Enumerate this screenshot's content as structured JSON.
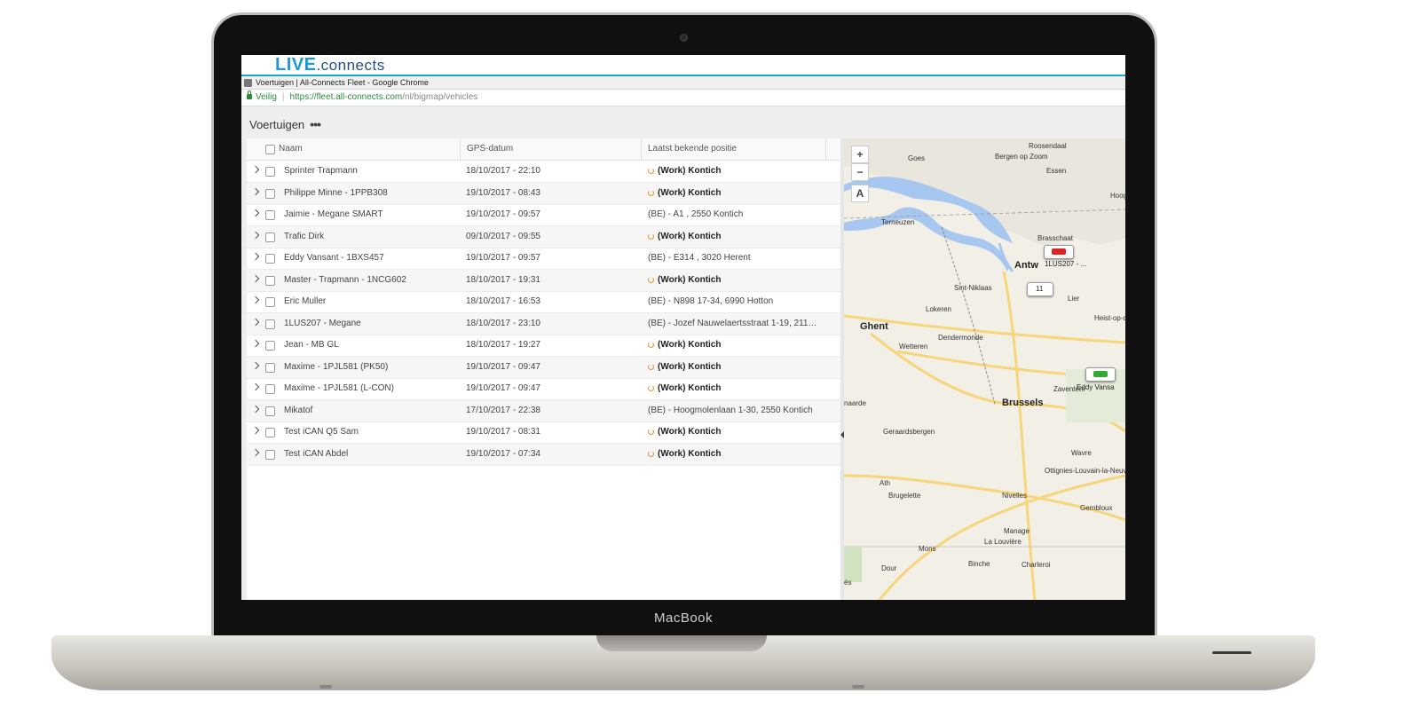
{
  "device": {
    "brand": "MacBook"
  },
  "app": {
    "logo_main": "LIVE",
    "logo_suffix": ".connects"
  },
  "window": {
    "title": "Voertuigen | All-Connects Fleet - Google Chrome"
  },
  "address_bar": {
    "secure_label": "Veilig",
    "url_host": "https://fleet.all-connects.com",
    "url_path": "/nl/bigmap/vehicles"
  },
  "page": {
    "title": "Voertuigen",
    "more_label": "•••"
  },
  "table": {
    "headers": {
      "name": "Naam",
      "gps_date": "GPS-datum",
      "last_position": "Laatst bekende positie"
    },
    "rows": [
      {
        "name": "Sprinter Trapmann",
        "gps": "18/10/2017 - 22:10",
        "position": "(Work) Kontich",
        "work": true
      },
      {
        "name": "Philippe Minne - 1PPB308",
        "gps": "19/10/2017 - 08:43",
        "position": "(Work) Kontich",
        "work": true
      },
      {
        "name": "Jaimie - Megane SMART",
        "gps": "19/10/2017 - 09:57",
        "position": "(BE) - A1 , 2550 Kontich",
        "work": false
      },
      {
        "name": "Trafic Dirk",
        "gps": "09/10/2017 - 09:55",
        "position": "(Work) Kontich",
        "work": true
      },
      {
        "name": "Eddy Vansant - 1BXS457",
        "gps": "19/10/2017 - 09:57",
        "position": "(BE) - E314 , 3020 Herent",
        "work": false
      },
      {
        "name": "Master - Trapmann - 1NCG602",
        "gps": "18/10/2017 - 19:31",
        "position": "(Work) Kontich",
        "work": true
      },
      {
        "name": "Eric Muller",
        "gps": "18/10/2017 - 16:53",
        "position": "(BE) - N898 17-34, 6990 Hotton",
        "work": false
      },
      {
        "name": "1LUS207 - Megane",
        "gps": "18/10/2017 - 23:10",
        "position": "(BE) - Jozef Nauwelaertsstraat 1-19, 2110 ...",
        "work": false
      },
      {
        "name": "Jean - MB GL",
        "gps": "18/10/2017 - 19:27",
        "position": "(Work) Kontich",
        "work": true
      },
      {
        "name": "Maxime - 1PJL581 (PK50)",
        "gps": "19/10/2017 - 09:47",
        "position": "(Work) Kontich",
        "work": true
      },
      {
        "name": "Maxime - 1PJL581 (L-CON)",
        "gps": "19/10/2017 - 09:47",
        "position": "(Work) Kontich",
        "work": true
      },
      {
        "name": "Mikatof",
        "gps": "17/10/2017 - 22:38",
        "position": "(BE) - Hoogmolenlaan 1-30, 2550 Kontich",
        "work": false
      },
      {
        "name": "Test iCAN Q5 Sam",
        "gps": "19/10/2017 - 08:31",
        "position": "(Work) Kontich",
        "work": true
      },
      {
        "name": "Test iCAN Abdel",
        "gps": "19/10/2017 - 07:34",
        "position": "(Work) Kontich",
        "work": true
      }
    ]
  },
  "map": {
    "zoom_in": "+",
    "zoom_out": "−",
    "layer": "A",
    "places": [
      "Roosendaal",
      "Goes",
      "Bergen op Zoom",
      "Essen",
      "Hoogst",
      "Terneuzen",
      "Brasschaat",
      "Antw",
      "Sint-Niklaas",
      "Lier",
      "Lokeren",
      "Heist-op-den",
      "Ghent",
      "Dendermonde",
      "Wetteren",
      "Zaventem",
      "naarde",
      "Brussels",
      "Geraardsbergen",
      "Wavre",
      "Ottignies-Louvain-la-Neuve",
      "Ath",
      "Brugelette",
      "Nivelles",
      "Gembloux",
      "Manage",
      "La Louvière",
      "Mons",
      "Binche",
      "Charleroi",
      "Dour",
      "és"
    ],
    "vehicles": [
      "1LUS207 - ...",
      "11",
      "Eddy Vansa"
    ]
  },
  "colors": {
    "accent": "#1aa7d8",
    "work_icon": "#e8922a",
    "secure": "#2e8b3c"
  }
}
